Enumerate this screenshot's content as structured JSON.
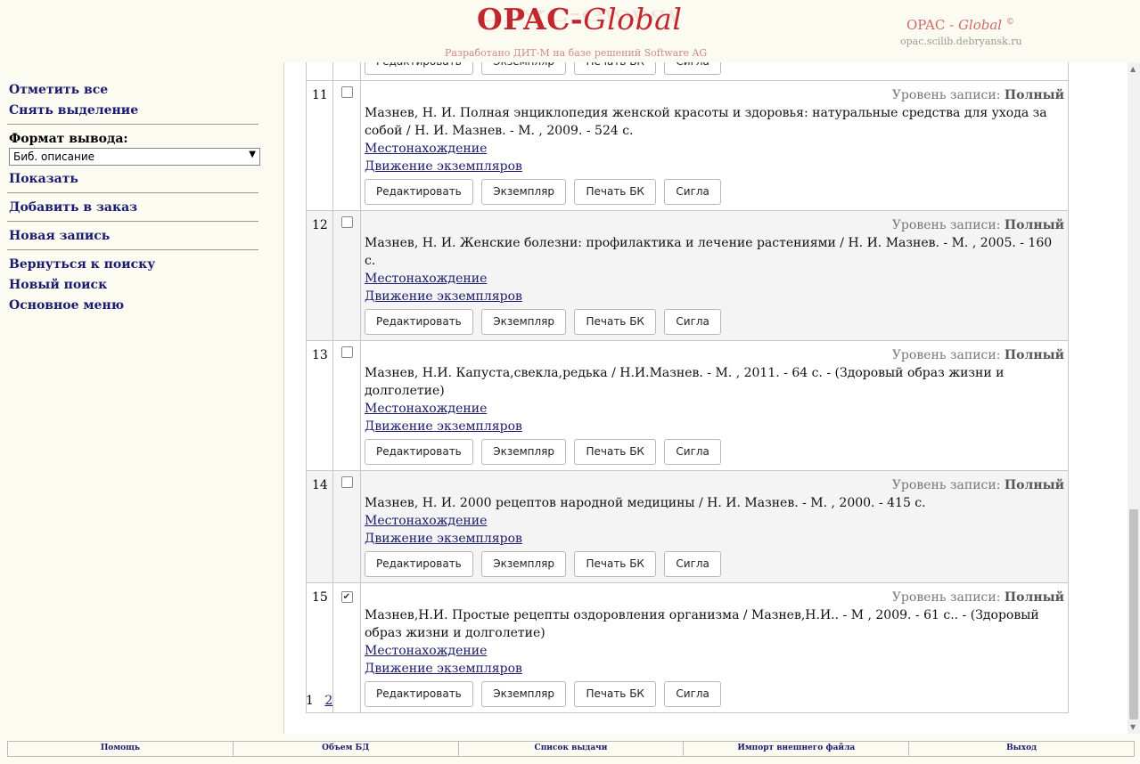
{
  "header": {
    "logo_main": "OPAC-",
    "logo_italic": "Global",
    "subtitle": "Разработано ДИТ-М на базе решений Software AG",
    "brand_right_main": "OPAC - ",
    "brand_right_italic": "Global",
    "brand_right_mark": "©",
    "brand_url": "opac.scilib.debryansk.ru"
  },
  "sidebar": {
    "select_all": "Отметить все",
    "deselect": "Снять выделение",
    "format_label": "Формат вывода:",
    "format_value": "Биб. описание",
    "show": "Показать",
    "add_order": "Добавить в заказ",
    "new_record": "Новая запись",
    "back_search": "Вернуться к поиску",
    "new_search": "Новый поиск",
    "main_menu": "Основное меню"
  },
  "labels": {
    "level_prefix": "Уровень записи:",
    "location": "Местонахождение",
    "movement": "Движение экземпляров",
    "edit": "Редактировать",
    "copy": "Экземпляр",
    "print_bk": "Печать БК",
    "sigla": "Сигла"
  },
  "records": [
    {
      "num": "11",
      "checked": false,
      "level": "Полный",
      "desc": "Мазнев, Н. И. Полная энциклопедия женской красоты и здоровья: натуральные средства для ухода за собой / Н. И. Мазнев. - М. , 2009. - 524 с."
    },
    {
      "num": "12",
      "checked": false,
      "level": "Полный",
      "desc": "Мазнев, Н. И. Женские болезни: профилактика и лечение растениями / Н. И. Мазнев. - М. , 2005. - 160 с."
    },
    {
      "num": "13",
      "checked": false,
      "level": "Полный",
      "desc": "Мазнев, Н.И. Капуста,свекла,редька / Н.И.Мазнев. - М. , 2011. - 64 с. - (Здоровый образ жизни и долголетие)"
    },
    {
      "num": "14",
      "checked": false,
      "level": "Полный",
      "desc": "Мазнев, Н. И. 2000 рецептов народной медицины / Н. И. Мазнев. - М. , 2000. - 415 с."
    },
    {
      "num": "15",
      "checked": true,
      "level": "Полный",
      "desc": "Мазнев,Н.И. Простые рецепты оздоровления организма / Мазнев,Н.И.. - М , 2009. - 61 с.. - (Здоровый образ жизни и долголетие)"
    }
  ],
  "pager": {
    "current": "1",
    "next": "2"
  },
  "footer": {
    "help": "Помощь",
    "db_volume": "Объем БД",
    "issued_list": "Список выдачи",
    "import_file": "Импорт внешнего файла",
    "exit": "Выход"
  }
}
